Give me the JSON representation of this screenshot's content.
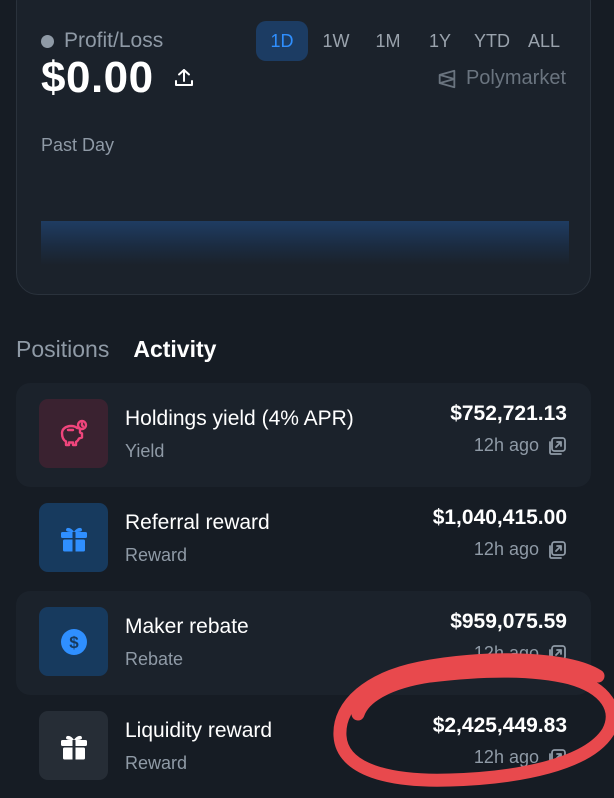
{
  "colors": {
    "background": "#161c24",
    "card": "#1b222b",
    "accent": "#2f8fff",
    "muted": "#8f9aa6",
    "annotation": "#e8494d"
  },
  "pnl": {
    "label": "Profit/Loss",
    "amount": "$0.00",
    "period": "Past Day",
    "brand": "Polymarket",
    "ranges": [
      "1D",
      "1W",
      "1M",
      "1Y",
      "YTD",
      "ALL"
    ],
    "selected_range": "1D"
  },
  "tabs": {
    "positions": "Positions",
    "activity": "Activity",
    "selected": "Activity"
  },
  "activity": [
    {
      "title": "Holdings yield (4% APR)",
      "type": "Yield",
      "amount": "$752,721.13",
      "time": "12h ago",
      "icon": "piggy-bank-icon",
      "icon_color": "#f0457c",
      "icon_bg": "#3a2230"
    },
    {
      "title": "Referral reward",
      "type": "Reward",
      "amount": "$1,040,415.00",
      "time": "12h ago",
      "icon": "gift-icon",
      "icon_color": "#2f8fff",
      "icon_bg": "#173a5e"
    },
    {
      "title": "Maker rebate",
      "type": "Rebate",
      "amount": "$959,075.59",
      "time": "12h ago",
      "icon": "dollar-coin-icon",
      "icon_color": "#2f8fff",
      "icon_bg": "#173a5e"
    },
    {
      "title": "Liquidity reward",
      "type": "Reward",
      "amount": "$2,425,449.83",
      "time": "12h ago",
      "icon": "gift-icon",
      "icon_color": "#ffffff",
      "icon_bg": "#262d36"
    }
  ]
}
